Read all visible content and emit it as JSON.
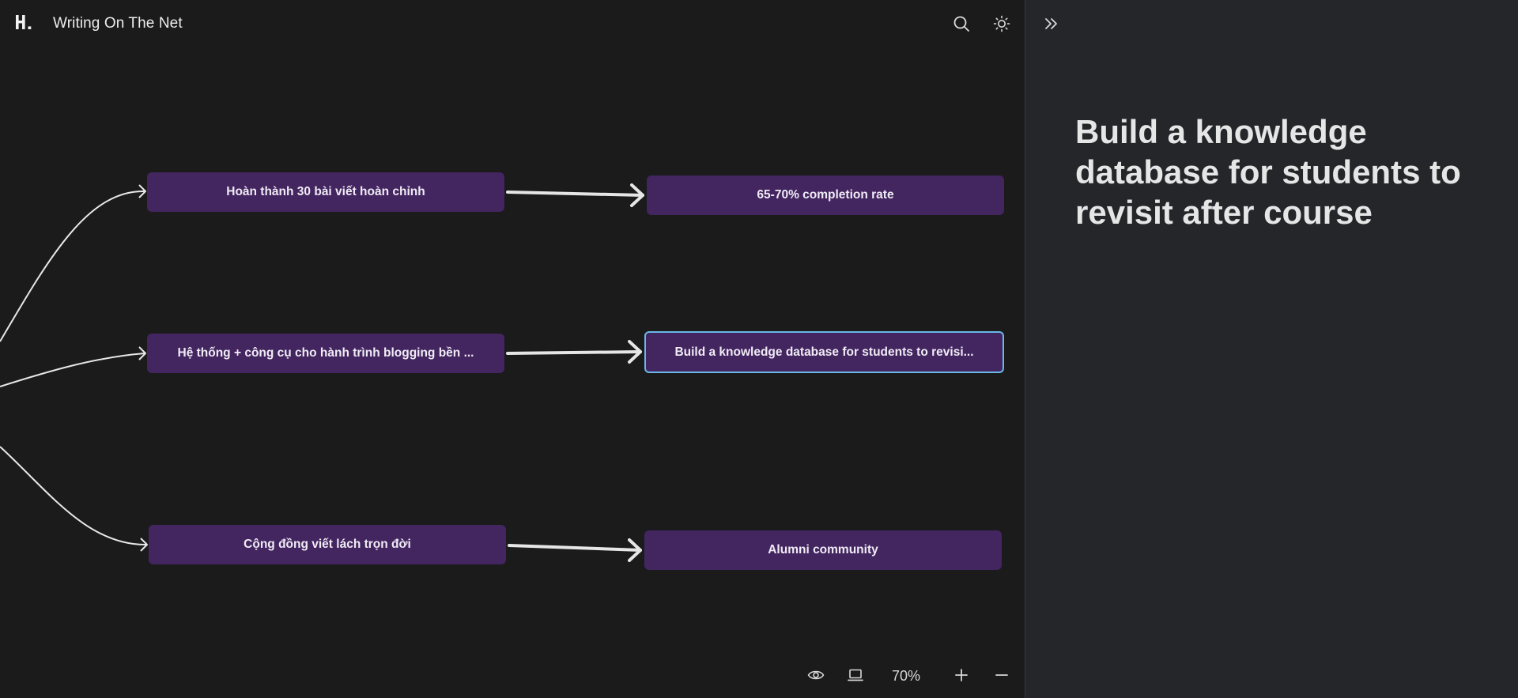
{
  "header": {
    "logo_text": "H.",
    "title": "Writing On The Net",
    "search_icon": "search-icon",
    "theme_icon": "sun-icon"
  },
  "canvas": {
    "nodes": [
      {
        "id": "n1",
        "label": "Hoàn thành 30 bài viết hoàn chỉnh"
      },
      {
        "id": "n2",
        "label": "Hệ thống + công cụ cho hành trình blogging bền ..."
      },
      {
        "id": "n3",
        "label": "Cộng đồng viết lách trọn đời"
      },
      {
        "id": "n4",
        "label": "65-70% completion rate"
      },
      {
        "id": "n5",
        "label": "Build a knowledge database for students to revisi...",
        "selected": true
      },
      {
        "id": "n6",
        "label": "Alumni community"
      }
    ],
    "edges": [
      {
        "from": "n1",
        "to": "n4"
      },
      {
        "from": "n2",
        "to": "n5"
      },
      {
        "from": "n3",
        "to": "n6"
      }
    ],
    "colors": {
      "node_fill": "#432560",
      "selected_border": "#69b8e8",
      "edge": "#e8e8e8",
      "background": "#1b1b1c"
    }
  },
  "toolbar": {
    "zoom_label": "70%",
    "eye_icon": "eye-icon",
    "laptop_icon": "laptop-icon",
    "zoom_in_icon": "plus-icon",
    "zoom_out_icon": "minus-icon"
  },
  "panel": {
    "collapse_icon": "chevrons-right-icon",
    "title": "Build a knowledge database for students to revisit after course"
  }
}
